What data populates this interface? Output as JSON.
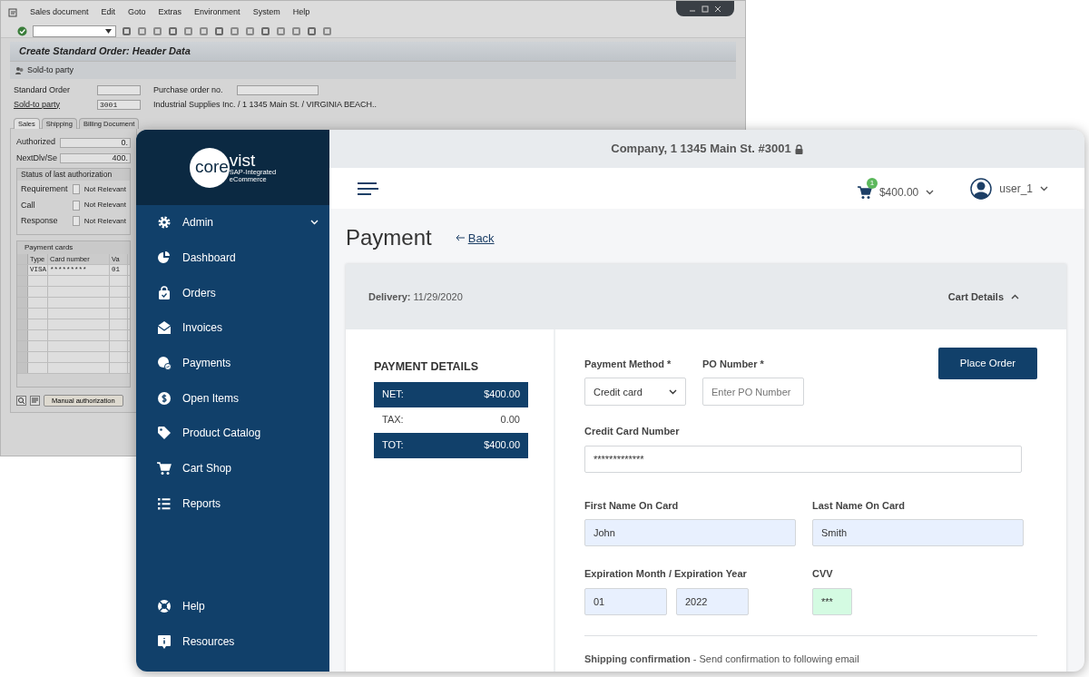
{
  "sap_window": {
    "menu": [
      "Sales document",
      "Edit",
      "Goto",
      "Extras",
      "Environment",
      "System",
      "Help"
    ],
    "title": "Create Standard Order: Header Data",
    "app_toolbar": [
      "Sold-to party"
    ],
    "header_fields": [
      {
        "label": "Standard Order",
        "link": false
      },
      {
        "label": "Purchase order no.",
        "link": false
      },
      {
        "label": "Sold-to party",
        "link": true,
        "value": "3001",
        "description": "Industrial Supplies Inc. / 1 1345 Main St. / VIRGINIA BEACH.."
      }
    ],
    "tabs": [
      {
        "label": "Sales",
        "selected": true
      },
      {
        "label": "Shipping",
        "selected": false
      },
      {
        "label": "Billing Document",
        "selected": false
      }
    ],
    "amounts": [
      {
        "label": "Authorized",
        "value": "0."
      },
      {
        "label": "NextDlv/Se",
        "value": "400."
      }
    ],
    "status_group": {
      "title": "Status of last authorization",
      "rows": [
        {
          "label": "Requirement",
          "status": "Not Relevant",
          "checked": false
        },
        {
          "label": "Call",
          "status": "Not Relevant",
          "checked": false
        },
        {
          "label": "Response",
          "status": "Not Relevant",
          "checked": false
        }
      ]
    },
    "payment_cards": {
      "title": "Payment cards",
      "columns": [
        "Type",
        "Card number",
        "Va"
      ],
      "rows": [
        [
          "VISA",
          "*********",
          "01"
        ]
      ]
    },
    "buttons": [
      "Manual authorization"
    ]
  },
  "app": {
    "logo": {
      "part_1": "core",
      "part_2": "vist",
      "tagline_1": "SAP-Integrated",
      "tagline_2": "eCommerce"
    },
    "sidebar": {
      "items": [
        {
          "label": "Admin",
          "expanded": false
        },
        {
          "label": "Dashboard"
        },
        {
          "label": "Orders"
        },
        {
          "label": "Invoices"
        },
        {
          "label": "Payments"
        },
        {
          "label": "Open Items"
        },
        {
          "label": "Product Catalog"
        },
        {
          "label": "Cart Shop"
        },
        {
          "label": "Reports"
        }
      ],
      "bottom_items": [
        {
          "label": "Help"
        },
        {
          "label": "Resources"
        }
      ]
    },
    "company_bar": "Company, 1 1345 Main St. #3001",
    "header": {
      "cart_count": "1",
      "cart_total": "$400.00",
      "user": "user_1"
    },
    "page_title": "Payment",
    "back_link": "Back",
    "delivery": "**Delivery:** 11/29/2020",
    "cart_details": {
      "label": "Cart Details",
      "expanded": true
    },
    "payment_details": {
      "title": "PAYMENT DETAILS",
      "rows": [
        {
          "label": "NET:",
          "value": "$400.00",
          "kind": "highlight"
        },
        {
          "label": "TAX:",
          "value": "0.00",
          "kind": "plain"
        },
        {
          "label": "TOT:",
          "value": "$400.00",
          "kind": "highlight"
        }
      ]
    },
    "payment_method": {
      "label": "Payment Method *",
      "value": "Credit card"
    },
    "po_number": {
      "label": "PO Number *",
      "placeholder": "Enter PO Number"
    },
    "place_order": "Place Order",
    "credit_card": {
      "label": "Credit Card Number",
      "value": "*************"
    },
    "first_name": {
      "label": "First Name On Card",
      "value": "John",
      "kind": "autofill"
    },
    "last_name": {
      "label": "Last Name On Card",
      "value": "Smith",
      "kind": "autofill"
    },
    "expiration": {
      "label": "Expiration Month / Expiration Year",
      "month": "01",
      "year": "2022",
      "kind": "autofill"
    },
    "cvv": {
      "label": "CVV",
      "value": "***",
      "kind": "valid"
    },
    "shipping_confirmation": "**Shipping confirmation** - Send confirmation to following email"
  }
}
